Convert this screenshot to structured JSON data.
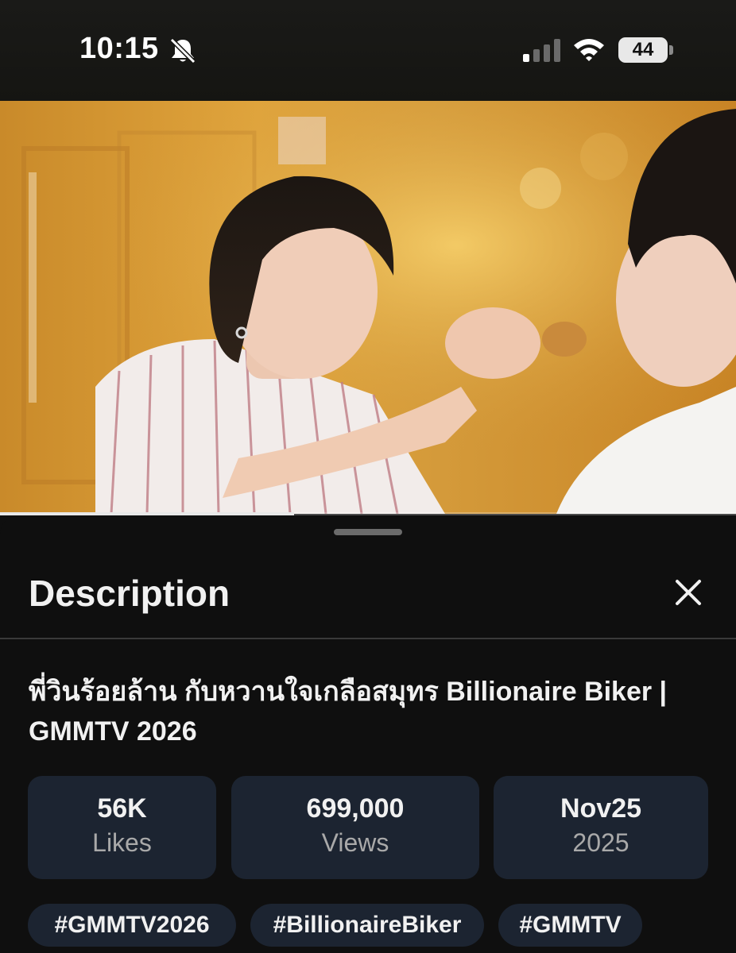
{
  "status_bar": {
    "time": "10:15",
    "battery": "44",
    "icons": [
      "bell-slash-icon",
      "cellular-signal-icon",
      "wifi-icon",
      "battery-icon"
    ]
  },
  "video": {
    "playback_progress": 0.4
  },
  "description_sheet": {
    "heading": "Description",
    "close_icon": "close-icon",
    "video_title": "พี่วินร้อยล้าน กับหวานใจเกลือสมุทร Billionaire Biker | GMMTV 2026",
    "stats": [
      {
        "value": "56K",
        "label": "Likes"
      },
      {
        "value": "699,000",
        "label": "Views"
      },
      {
        "value": "Nov25",
        "label": "2025"
      }
    ],
    "hashtags": [
      "#GMMTV2026",
      "#BillionaireBiker",
      "#GMMTV"
    ]
  },
  "colors": {
    "background": "#0f0f0f",
    "chip": "#1c2431",
    "text": "#f1f1f1",
    "muted_text": "#a9a9a9"
  }
}
